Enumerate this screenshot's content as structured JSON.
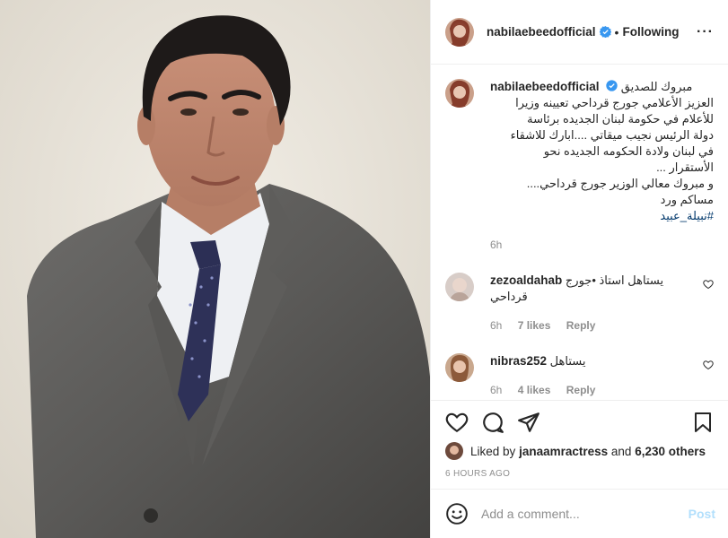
{
  "post": {
    "username": "nabilaebeedofficial",
    "follow_status": "Following",
    "caption_lines": [
      "مبروك للصديق",
      "العزيز الأعلامي جورج قرداحي تعيينه وزيرا",
      "للأعلام في حكومة لبنان الجديده برئاسة",
      "دولة الرئيس نجيب ميقاتي ....ابارك للاشقاء",
      "في لبنان ولادة الحكومه الجديده نحو",
      "الأستقرار ...",
      "و مبروك معالي الوزير جورج قرداحي....",
      "مساكم ورد"
    ],
    "hashtag": "#نبيلة_عبيد",
    "caption_time": "6h"
  },
  "comments": [
    {
      "username": "zezoaldahab",
      "text": "يستاهل استاذ •جورج قرداحي",
      "time": "6h",
      "likes": "7 likes",
      "reply": "Reply"
    },
    {
      "username": "nibras252",
      "text": "يستاهل",
      "time": "6h",
      "likes": "4 likes",
      "reply": "Reply"
    }
  ],
  "likes_info": {
    "prefix": "Liked by",
    "liker": "janaamractress",
    "conj": "and",
    "others": "6,230 others"
  },
  "posted_ago": "6 HOURS AGO",
  "add_comment": {
    "placeholder": "Add a comment...",
    "post_label": "Post"
  },
  "icons": {
    "verified": "verified-badge-icon",
    "like": "heart-icon",
    "comment": "comment-bubble-icon",
    "share": "paper-plane-icon",
    "save": "bookmark-icon",
    "emoji": "smiley-icon",
    "more": "ellipsis-icon"
  },
  "colors": {
    "verified": "#3897f0",
    "link": "#00376b",
    "muted": "#8e8e8e",
    "post_disabled": "#b2dffc"
  }
}
